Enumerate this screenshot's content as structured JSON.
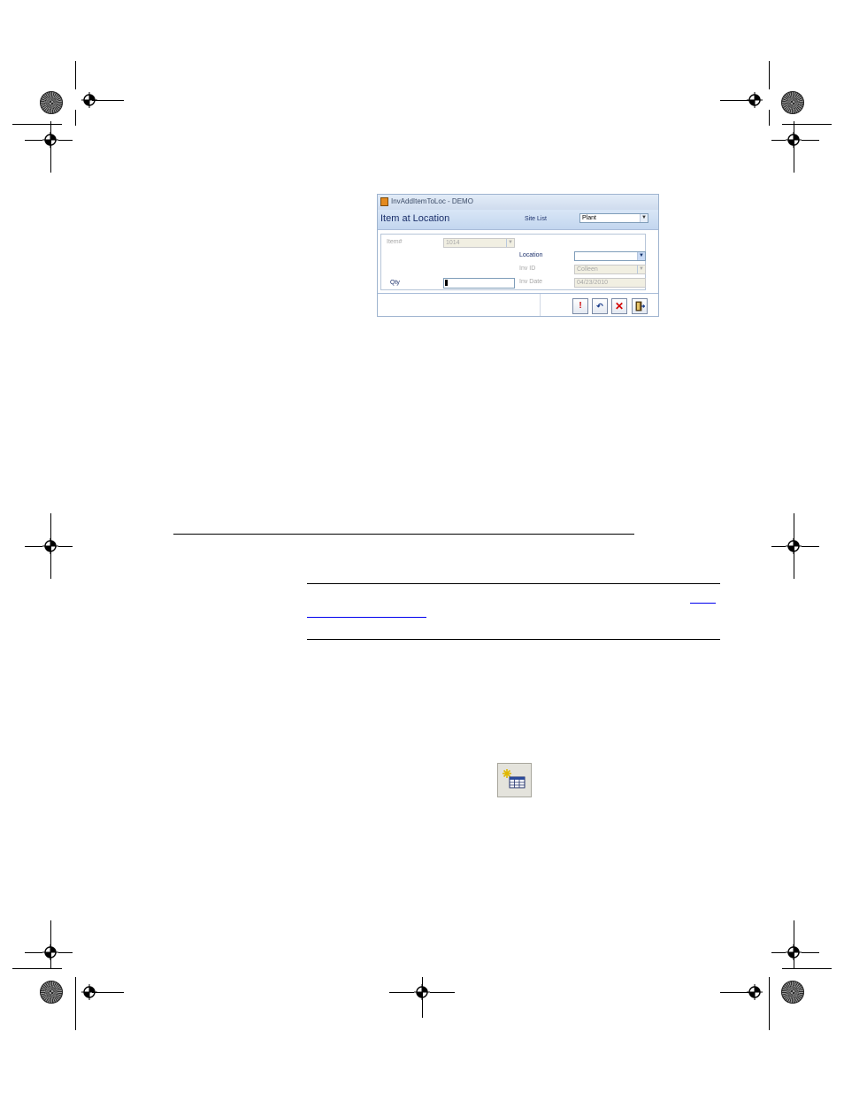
{
  "dialog": {
    "window_title": "InvAddItemToLoc - DEMO",
    "heading": "Item at Location",
    "site_list_label": "Site List",
    "site_list_value": "Plant",
    "fields": {
      "item_label": "Item#",
      "item_value": "1014",
      "location_label": "Location",
      "location_value": "",
      "inv_id_label": "Inv ID",
      "inv_id_value": "Colleen",
      "qty_label": "Qty",
      "qty_value": "",
      "inv_date_label": "Inv Date",
      "inv_date_value": "04/23/2010"
    },
    "toolbar": {
      "save_glyph": "!",
      "undo_glyph": "↶",
      "delete_glyph": "✕",
      "exit_glyph": "▯"
    }
  },
  "document": {
    "link_text_line1": "",
    "link_text_line2": ""
  },
  "icons": {
    "new_record_icon": "new-grid-icon",
    "registration_mark": "crosshair-target-icon"
  },
  "colors": {
    "header_blue": "#c3d6ef",
    "heading_text": "#1a2f6a",
    "delete_red": "#d40000",
    "save_red": "#cc0000"
  }
}
